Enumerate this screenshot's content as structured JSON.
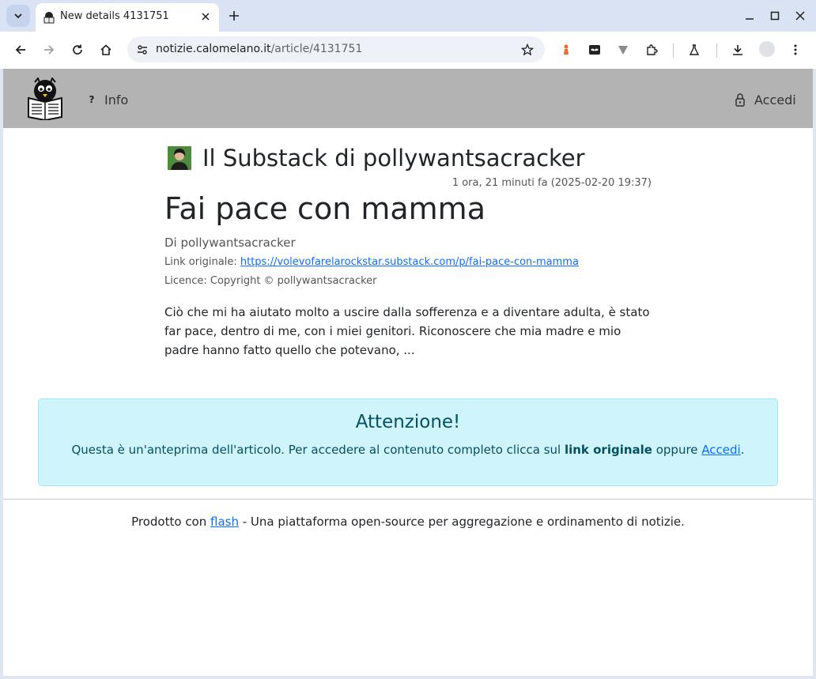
{
  "browser": {
    "tab": {
      "title": "New details 4131751"
    },
    "url": {
      "host": "notizie.calomelano.it",
      "path": "/article/4131751"
    }
  },
  "site_nav": {
    "info_icon": "?",
    "info_label": "Info",
    "login_label": "Accedi"
  },
  "article": {
    "source_title": "Il Substack di pollywantsacracker",
    "timestamp": "1 ora, 21 minuti fa (2025-02-20 19:37)",
    "title": "Fai pace con mamma",
    "byline": "Di pollywantsacracker",
    "link_label": "Link originale:",
    "link_url": "https://volevofarelarockstar.substack.com/p/fai-pace-con-mamma",
    "licence": "Licence: Copyright © pollywantsacracker",
    "excerpt": "Ciò che mi ha aiutato molto a uscire dalla sofferenza e a diventare adulta, è stato far pace, dentro di me, con i miei genitori. Riconoscere che mia madre e mio padre hanno fatto quello che potevano, ..."
  },
  "alert": {
    "title": "Attenzione!",
    "text_before": "Questa è un'anteprima dell'articolo. Per accedere al contenuto completo clicca sul ",
    "bold_text": "link originale",
    "text_middle": " oppure ",
    "link_text": "Accedi",
    "text_after": "."
  },
  "footer": {
    "text_before": "Prodotto con ",
    "link_text": "flash",
    "text_after": " - Una piattaforma open-source per aggregazione e ordinamento di notizie."
  },
  "colors": {
    "nav_bg": "#b3b3b3",
    "alert_bg": "#cff4fc",
    "alert_text": "#055160",
    "link": "#0d6efd"
  }
}
